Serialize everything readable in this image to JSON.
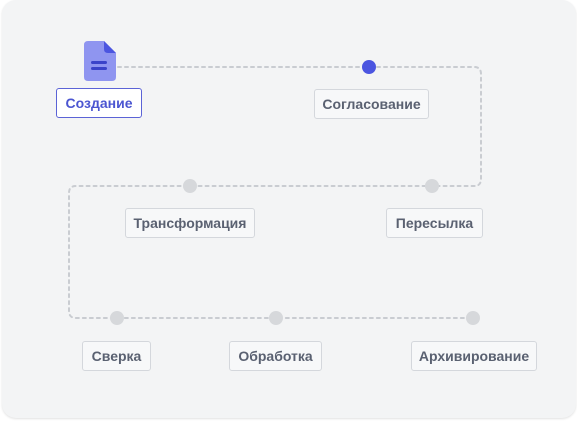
{
  "colors": {
    "active": "#4b55e0",
    "inactive": "#d6d8db",
    "connector": "#c9ccd1",
    "label_text": "#5a6171",
    "active_text": "#4b55d1"
  },
  "steps": [
    {
      "label": "Создание",
      "state": "active",
      "icon": "document-icon"
    },
    {
      "label": "Согласование",
      "state": "current"
    },
    {
      "label": "Пересылка",
      "state": "pending"
    },
    {
      "label": "Трансформация",
      "state": "pending"
    },
    {
      "label": "Сверка",
      "state": "pending"
    },
    {
      "label": "Обработка",
      "state": "pending"
    },
    {
      "label": "Архивирование",
      "state": "pending"
    }
  ]
}
